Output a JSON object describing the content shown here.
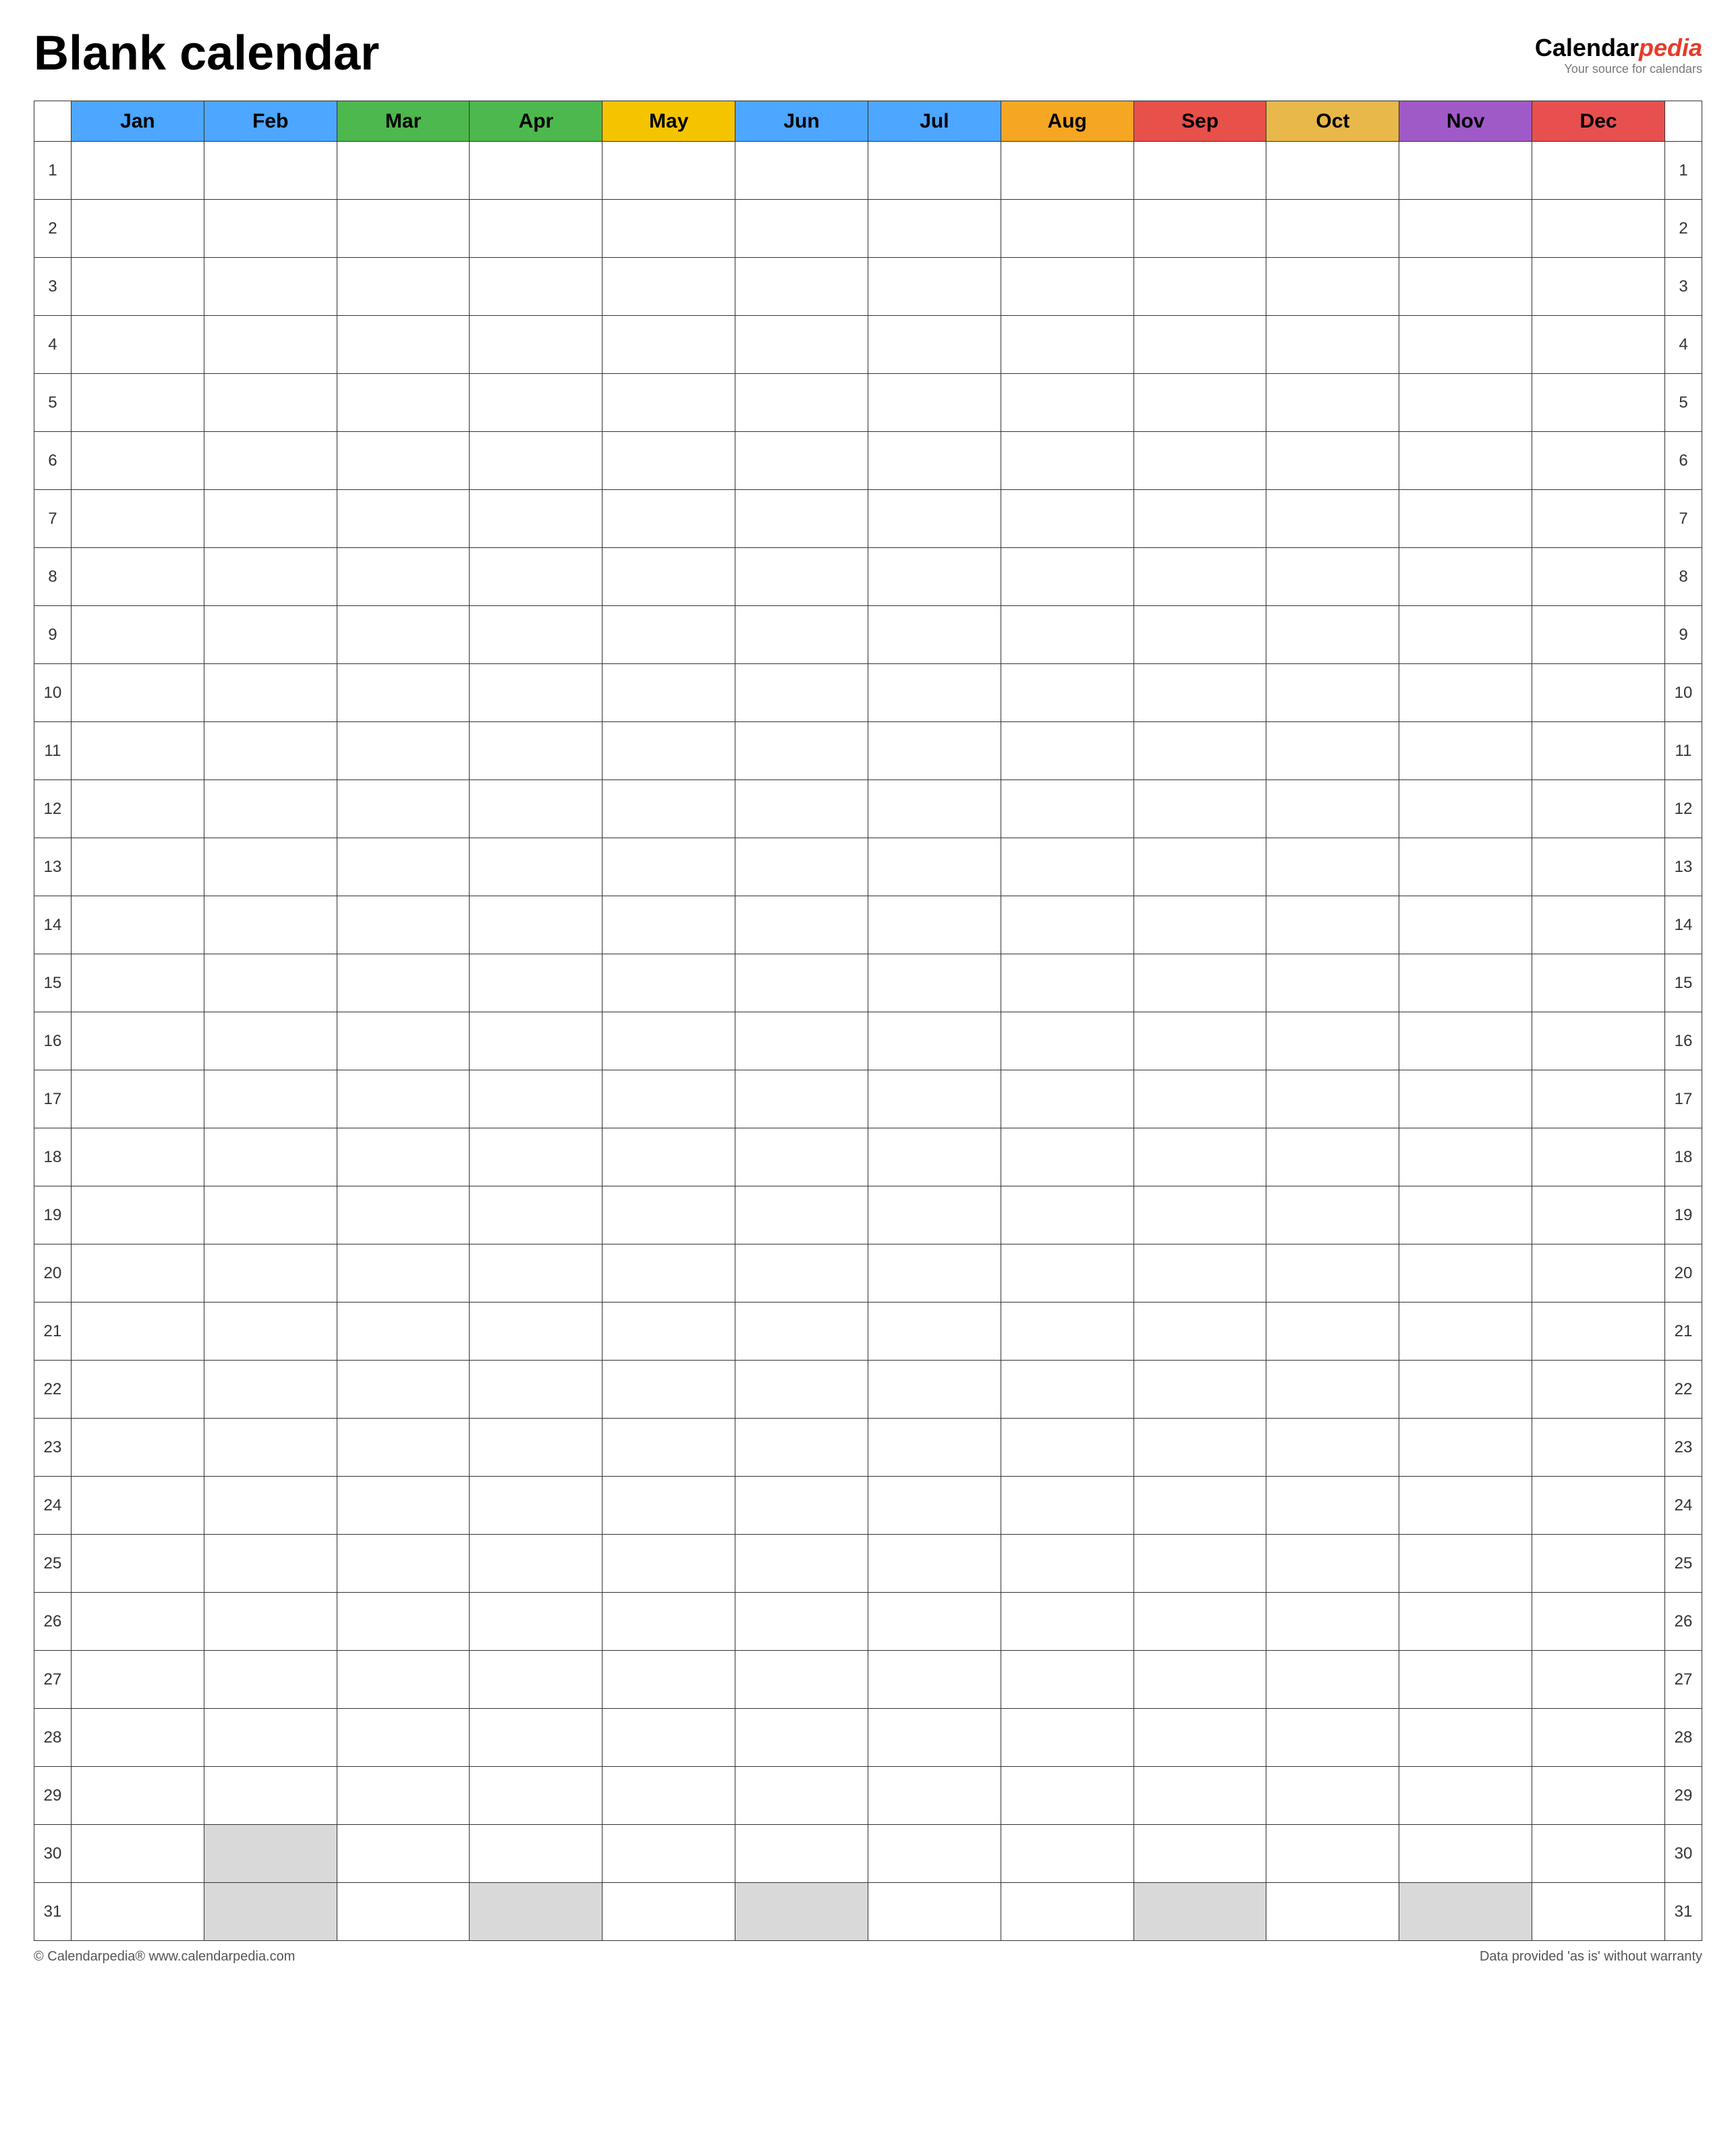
{
  "header": {
    "title": "Blank calendar",
    "logo": {
      "brand": "Calendar",
      "brand_italic": "pedia",
      "tagline": "Your source for calendars"
    }
  },
  "months": [
    {
      "label": "Jan",
      "class": "month-jan"
    },
    {
      "label": "Feb",
      "class": "month-feb"
    },
    {
      "label": "Mar",
      "class": "month-mar"
    },
    {
      "label": "Apr",
      "class": "month-apr"
    },
    {
      "label": "May",
      "class": "month-may"
    },
    {
      "label": "Jun",
      "class": "month-jun"
    },
    {
      "label": "Jul",
      "class": "month-jul"
    },
    {
      "label": "Aug",
      "class": "month-aug"
    },
    {
      "label": "Sep",
      "class": "month-sep"
    },
    {
      "label": "Oct",
      "class": "month-oct"
    },
    {
      "label": "Nov",
      "class": "month-nov"
    },
    {
      "label": "Dec",
      "class": "month-dec"
    }
  ],
  "days": [
    1,
    2,
    3,
    4,
    5,
    6,
    7,
    8,
    9,
    10,
    11,
    12,
    13,
    14,
    15,
    16,
    17,
    18,
    19,
    20,
    21,
    22,
    23,
    24,
    25,
    26,
    27,
    28,
    29,
    30,
    31
  ],
  "grey_days": {
    "30": [
      "Feb"
    ],
    "31": [
      "Feb",
      "Apr",
      "Jun",
      "Sep",
      "Nov"
    ]
  },
  "footer": {
    "left": "© Calendarpedia®  www.calendarpedia.com",
    "right": "Data provided 'as is' without warranty"
  }
}
